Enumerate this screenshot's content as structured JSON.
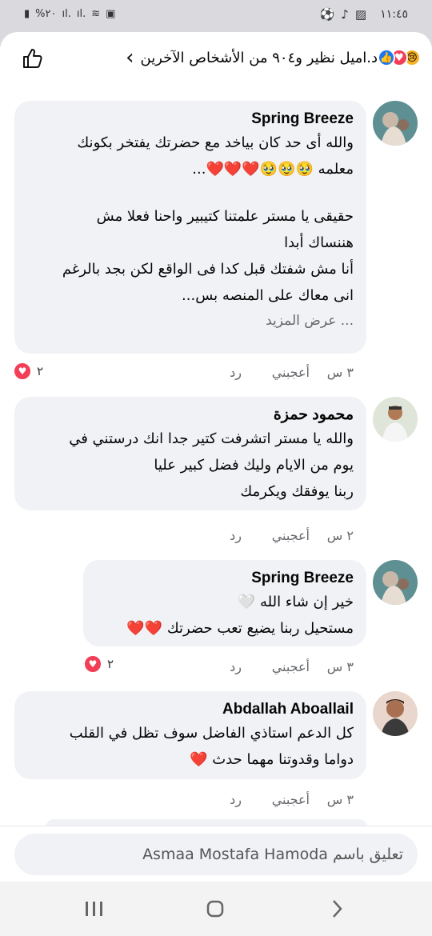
{
  "status_bar": {
    "time": "١١:٤٥",
    "battery": "%٢٠"
  },
  "header": {
    "summary": "د.اميل نظير و٩٠٤ من الأشخاص الآخرين",
    "chevron": "‹",
    "like_icon": "thumbs-up-outline-icon"
  },
  "comments": [
    {
      "author": "Spring Breeze",
      "lines": [
        "والله أى حد كان بياخد مع حضرتك يفتخر بكونك",
        "معلمه 🥹🥹🥹❤️❤️❤️...",
        "",
        "حقيقى يا مستر علمتنا كتيبير واحنا فعلا مش",
        "هننساك أبدا",
        "أنا مش شفتك قبل كدا فى الواقع لكن بجد بالرغم",
        "انى معاك على المنصه بس..."
      ],
      "see_more": "... عرض المزيد",
      "time": "٣ س",
      "like": "أعجبني",
      "reply": "رد",
      "reaction_count": "٢"
    },
    {
      "author": "محمود حمزة",
      "lines": [
        "والله يا مستر اتشرفت كتير جدا انك درستني في",
        "يوم من الايام وليك فضل كبير عليا",
        "ربنا يوفقك ويكرمك"
      ],
      "time": "٢ س",
      "like": "أعجبني",
      "reply": "رد"
    },
    {
      "author": "Spring Breeze",
      "lines": [
        "خير إن شاء الله 🤍",
        "مستحيل ربنا يضيع تعب حضرتك ❤️❤️"
      ],
      "time": "٣ س",
      "like": "أعجبني",
      "reply": "رد",
      "reaction_count": "٢"
    },
    {
      "author": "Abdallah Aboallail",
      "lines": [
        "كل الدعم استاذي الفاضل سوف تظل في القلب",
        "دواما وقدوتنا مهما حدث ❤️"
      ],
      "time": "٣ س",
      "like": "أعجبني",
      "reply": "رد"
    }
  ],
  "composer": {
    "placeholder": "تعليق باسم Asmaa Mostafa Hamoda"
  },
  "navbar": {
    "recents": "recent-apps-icon",
    "home": "home-icon",
    "back": "back-icon"
  },
  "colors": {
    "bubble": "#f0f2f5",
    "like_blue": "#1877f2",
    "love_red": "#f33e58",
    "muted": "#65676b"
  }
}
